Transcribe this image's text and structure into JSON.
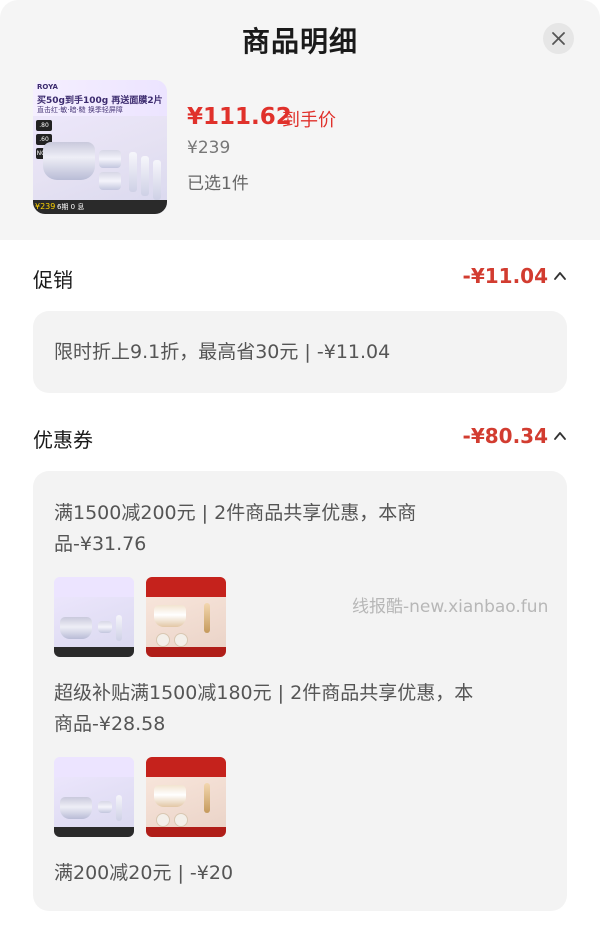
{
  "header": {
    "title": "商品明细"
  },
  "product": {
    "thumb": {
      "brand": "ROYA",
      "line1": "买50g到手100g 再送面膜2片",
      "line2": "直击红·敏·暗·糙 换季轻屏障",
      "badges": [
        ".80",
        ".60",
        "NO.1"
      ],
      "foot_price": "¥239",
      "foot_text": "6期 0 息"
    },
    "price_now": "¥111.62",
    "price_now_label": "到手价",
    "price_original": "¥239",
    "selected_text": "已选1件"
  },
  "promotion": {
    "title": "促销",
    "amount": "-¥11.04",
    "detail": "限时折上9.1折，最高省30元 | -¥11.04"
  },
  "coupon": {
    "title": "优惠券",
    "amount": "-¥80.34",
    "items": [
      {
        "text_line1": "满1500减200元 | 2件商品共享优惠，本商",
        "text_line2": "品-¥31.76"
      },
      {
        "text_line1": "超级补贴满1500减180元 | 2件商品共享优惠，本",
        "text_line2": "商品-¥28.58"
      },
      {
        "text_line1": "满200减20元 | -¥20"
      }
    ]
  },
  "watermark": "线报酷-new.xianbao.fun",
  "colors": {
    "accent": "#e0312b",
    "amount": "#d23c30",
    "header_bg": "#f5f5f5",
    "box_bg": "#f3f3f3"
  },
  "icons": {
    "close": "close-icon",
    "chevron": "chevron-up-icon"
  }
}
